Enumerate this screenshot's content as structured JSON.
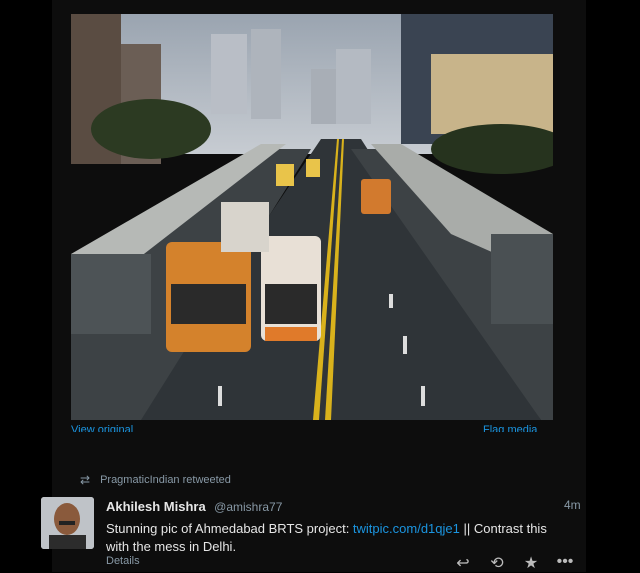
{
  "media": {
    "alt": "Ahmedabad BRTS photo",
    "view_original": "View original",
    "flag_media": "Flag media"
  },
  "retweet": {
    "icon": "retweet-icon",
    "text": "PragmaticIndian retweeted"
  },
  "tweet": {
    "name": "Akhilesh Mishra",
    "handle": "@amishra77",
    "time": "4m",
    "text_before": "Stunning pic of Ahmedabad BRTS project: ",
    "link": "twitpic.com/d1qje1",
    "text_after": " || Contrast this with the mess in Delhi.",
    "details": "Details"
  },
  "actions": [
    {
      "icon": "reply-icon",
      "glyph": "↩"
    },
    {
      "icon": "retweet-icon",
      "glyph": "⟲"
    },
    {
      "icon": "star-icon",
      "glyph": "★"
    },
    {
      "icon": "more-icon",
      "glyph": "•••"
    }
  ],
  "colors": {
    "background": "#000000",
    "panel": "#0d0d0d",
    "link": "#1b95e0",
    "muted": "#8899a6"
  }
}
